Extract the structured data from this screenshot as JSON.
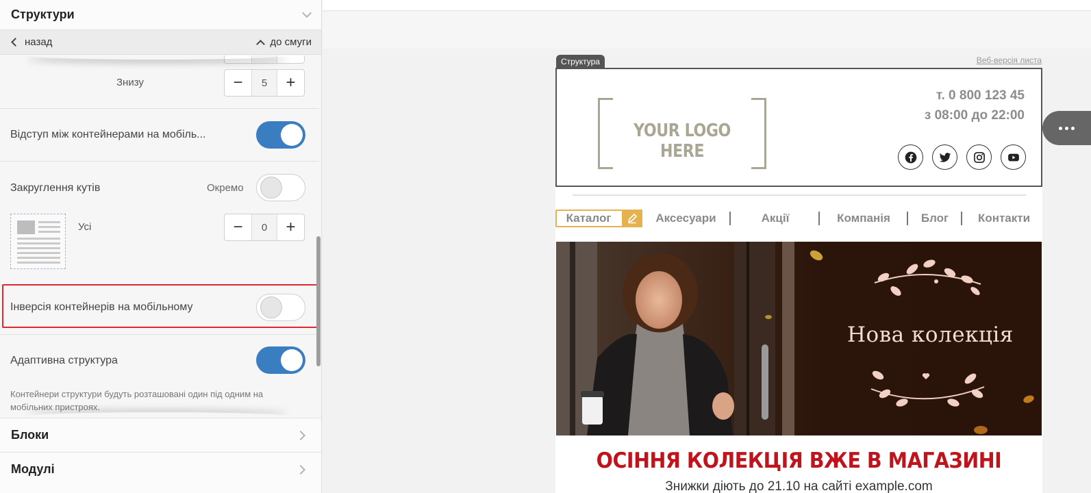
{
  "panel": {
    "section_title": "Структури",
    "back_label": "назад",
    "to_strip_label": "до смуги",
    "bottom_label": "Знизу",
    "bottom_value": "5",
    "mobile_spacing_label": "Відступ між контейнерами на мобіль...",
    "mobile_spacing_on": true,
    "rounding_label": "Закруглення кутів",
    "separately_label": "Окремо",
    "separately_on": false,
    "all_label": "Усі",
    "all_value": "0",
    "inversion_label": "Інверсія контейнерів на мобільному",
    "inversion_on": false,
    "adaptive_label": "Адаптивна структура",
    "adaptive_on": true,
    "adaptive_hint": "Контейнери структури будуть розташовані один під одним на мобільних пристроях.",
    "blocks_label": "Блоки",
    "modules_label": "Модулі"
  },
  "canvas": {
    "structure_tag": "Структура",
    "web_version_link": "Веб-версія листа",
    "logo_text": "YOUR LOGO HERE",
    "phone_line1": "т. 0 800 123 45",
    "phone_line2": "з 08:00 до 22:00",
    "socials": [
      "facebook-icon",
      "twitter-icon",
      "instagram-icon",
      "youtube-icon"
    ],
    "menu": [
      "Каталог",
      "Аксесуари",
      "Акції",
      "Компанія",
      "Блог",
      "Контакти"
    ],
    "banner_title": "Нова колекція",
    "headline": "ОСІННЯ КОЛЕКЦІЯ ВЖЕ В МАГАЗИНІ",
    "subline": "Знижки діють до 21.10 на сайті example.com"
  },
  "colors": {
    "accent_blue": "#3a7dc0",
    "highlight_red": "#e1262d",
    "menu_active": "#e6b24f",
    "headline_red": "#c0141c"
  }
}
